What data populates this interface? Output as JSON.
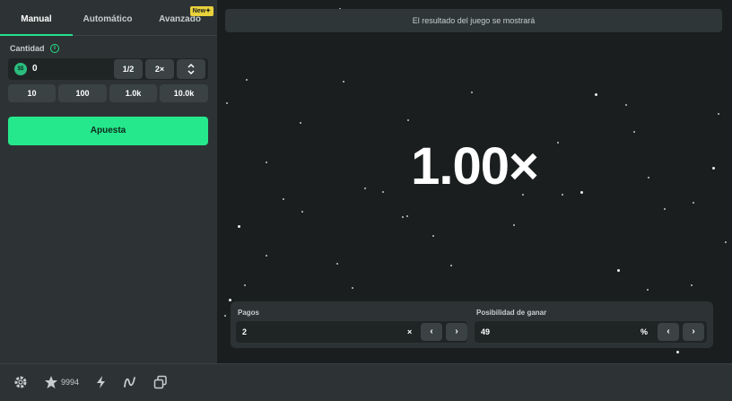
{
  "tabs": [
    {
      "label": "Manual"
    },
    {
      "label": "Automático"
    },
    {
      "label": "Avanzado"
    }
  ],
  "badge_new": "New",
  "amount": {
    "label": "Cantidad",
    "value": "0",
    "coin_text": "$$",
    "half_label": "1/2",
    "double_label": "2×"
  },
  "presets": [
    "10",
    "100",
    "1.0k",
    "10.0k"
  ],
  "bet_button_label": "Apuesta",
  "game": {
    "result_message": "El resultado del juego se mostrará",
    "multiplier": "1.00×"
  },
  "payout": {
    "label": "Pagos",
    "value": "2",
    "suffix": "×"
  },
  "win_chance": {
    "label": "Posibilidad de ganar",
    "value": "49",
    "suffix": "%"
  },
  "footer": {
    "star_count": "9994"
  },
  "colors": {
    "accent": "#25e88c",
    "panel": "#2d3334",
    "background": "#1b1e1f"
  },
  "icons": [
    "info-icon",
    "coin-icon",
    "chevron-up-down-icon",
    "chevron-left-icon",
    "chevron-right-icon",
    "settings-icon",
    "star-icon",
    "lightning-icon",
    "curve-icon",
    "layers-icon"
  ]
}
